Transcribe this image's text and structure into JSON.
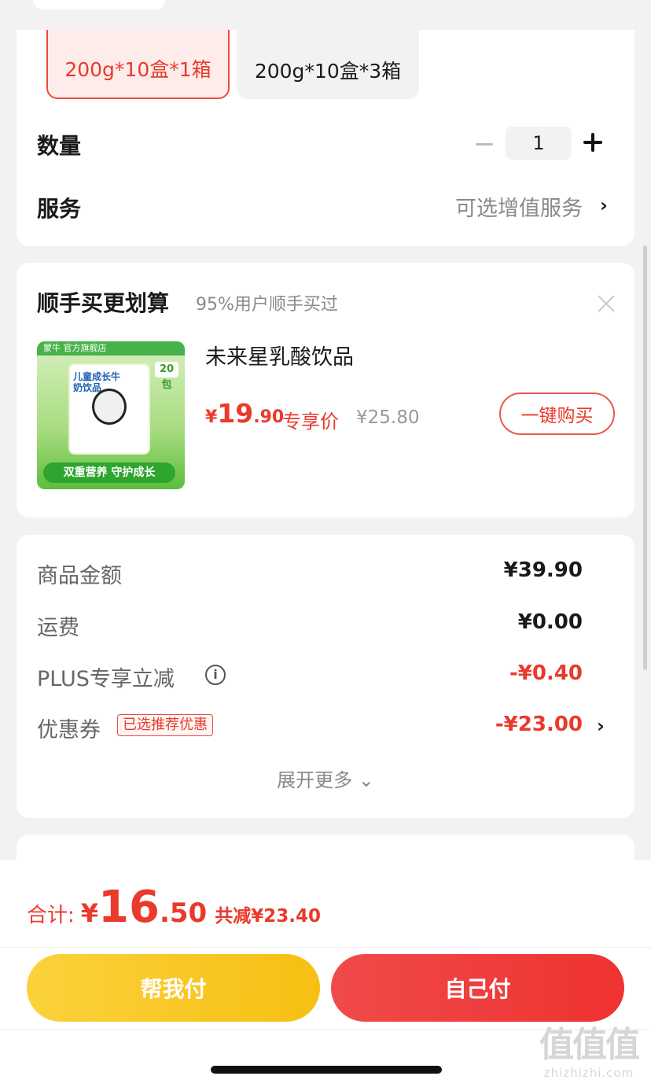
{
  "spec": {
    "options": [
      {
        "label": "200g*10盒*1箱",
        "selected": true
      },
      {
        "label": "200g*10盒*3箱",
        "selected": false
      }
    ],
    "quantity_label": "数量",
    "quantity_value": "1",
    "service_label": "服务",
    "service_value": "可选增值服务"
  },
  "bundle": {
    "title": "顺手买更划算",
    "subtitle": "95%用户顺手买过",
    "product": {
      "name": "未来星乳酸饮品",
      "price_yen": "¥",
      "price_int": "19",
      "price_dec": ".90",
      "price_tag": "专享价",
      "original_price": "¥25.80",
      "button_label": "一键购买",
      "thumb": {
        "store": "蒙牛 官方旗舰店",
        "box_title": "儿童成长牛奶饮品",
        "badge": "20包",
        "banner": "双重营养 守护成长"
      }
    }
  },
  "summary": {
    "rows": [
      {
        "label": "商品金额",
        "value": "¥39.90"
      },
      {
        "label": "运费",
        "value": "¥0.00"
      },
      {
        "label": "PLUS专享立减",
        "value": "-¥0.40"
      },
      {
        "label": "优惠券",
        "tag": "已选推荐优惠",
        "value": "-¥23.00"
      }
    ],
    "expand_label": "展开更多 ⌄"
  },
  "footer": {
    "total_label": "合计:",
    "total_yen": "¥",
    "total_int": "16",
    "total_dec": ".50",
    "saved": "共减¥23.40",
    "help_pay": "帮我付",
    "self_pay": "自己付"
  },
  "watermark": {
    "big": "值值值",
    "small": "zhizhizhi.com"
  },
  "colors": {
    "accent_red": "#e93a2c",
    "help_yellow": "#f7bf12",
    "self_red": "#ef3232"
  }
}
